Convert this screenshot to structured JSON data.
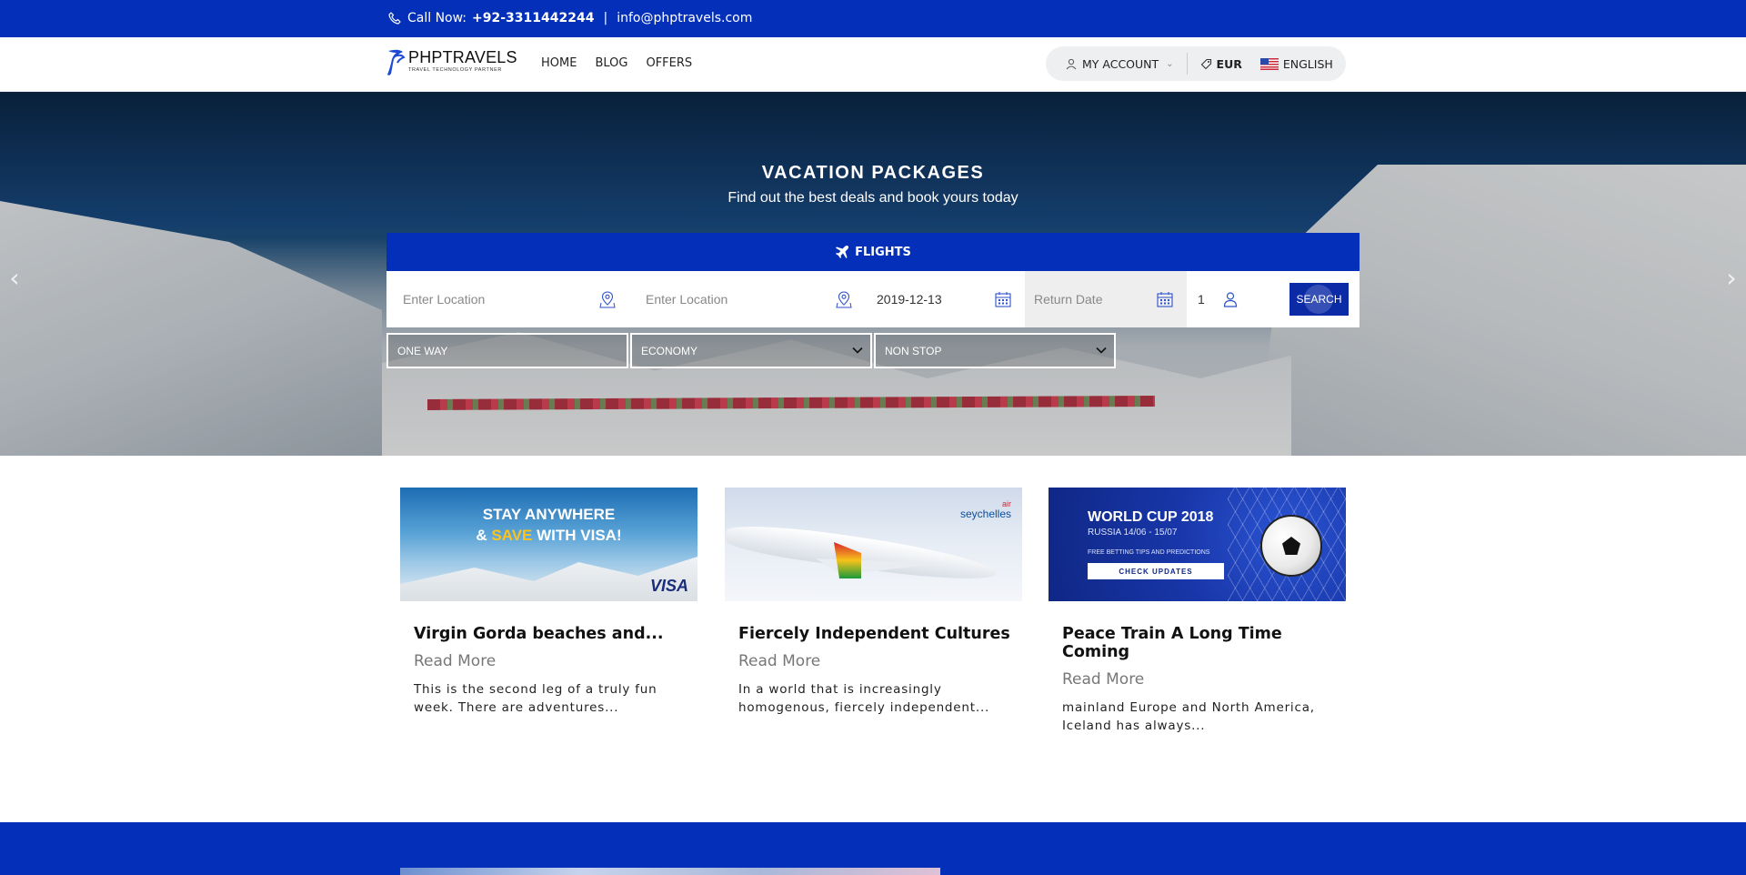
{
  "topbar": {
    "call_label": "Call Now:",
    "phone": "+92-3311442244",
    "separator": "|",
    "email": "info@phptravels.com"
  },
  "nav": {
    "logo_brand": "PHPTRAVELS",
    "logo_tagline": "TRAVEL TECHNOLOGY PARTNER",
    "menu": [
      "HOME",
      "BLOG",
      "OFFERS"
    ],
    "account_label": "MY ACCOUNT",
    "currency": "EUR",
    "language": "ENGLISH"
  },
  "hero": {
    "title": "VACATION PACKAGES",
    "subtitle": "Find out the best deals and book yours today"
  },
  "search": {
    "tab_label": "FLIGHTS",
    "from_placeholder": "Enter Location",
    "to_placeholder": "Enter Location",
    "depart_date": "2019-12-13",
    "return_placeholder": "Return Date",
    "passengers": "1",
    "button_label": "SEARCH",
    "trip_type": "ONE WAY",
    "cabin_class": "ECONOMY",
    "stops": "NON STOP"
  },
  "cards": [
    {
      "banner_line1": "STAY ANYWHERE",
      "banner_amp": "& ",
      "banner_save": "SAVE",
      "banner_line2_rest": " WITH VISA!",
      "banner_brand": "VISA",
      "title": "Virgin Gorda beaches and...",
      "read_more": "Read More",
      "excerpt": "This is the second leg of a truly fun week. There are adventures..."
    },
    {
      "banner_brand_top": "air",
      "banner_brand": "seychelles",
      "title": "Fiercely Independent Cultures",
      "read_more": "Read More",
      "excerpt": "In a world that is increasingly homogenous, fiercely independent..."
    },
    {
      "banner_title": "WORLD CUP 2018",
      "banner_sub": "RUSSIA 14/06 - 15/07",
      "banner_small": "FREE BETTING TIPS AND PREDICTIONS",
      "banner_button": "CHECK UPDATES",
      "title": "Peace Train A Long Time Coming",
      "read_more": "Read More",
      "excerpt": " mainland Europe and North America, Iceland has always..."
    }
  ],
  "colors": {
    "primary": "#0430b9",
    "search_button": "#0a2aa6"
  },
  "icons": {
    "phone": "phone-icon",
    "user": "user-icon",
    "currency": "tag-icon",
    "flag": "us-flag-icon",
    "plane": "plane-icon",
    "location": "location-pin-icon",
    "calendar": "calendar-icon",
    "passenger": "person-icon",
    "dropdown": "chevron-down-icon",
    "slide_prev": "chevron-left-icon",
    "slide_next": "chevron-right-icon"
  }
}
